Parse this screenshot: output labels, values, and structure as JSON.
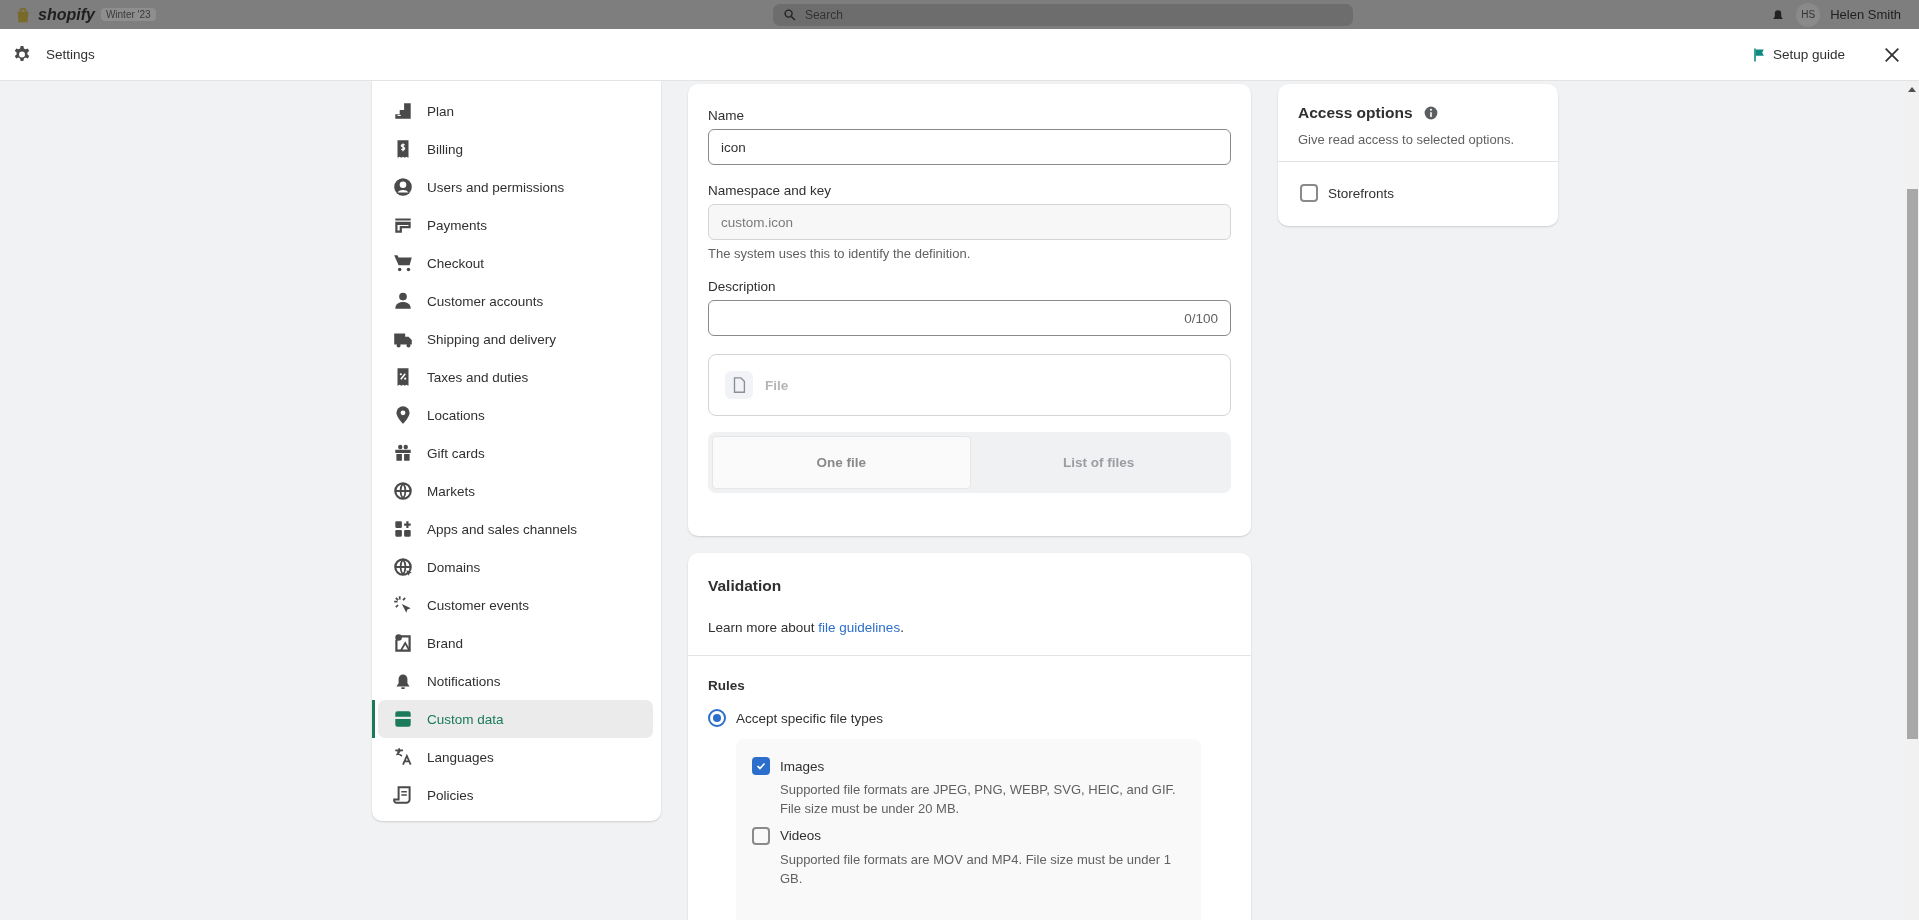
{
  "backdrop": {
    "logo": "shopify",
    "badge": "Winter '23",
    "search_placeholder": "Search",
    "avatar": "HS",
    "user": "Helen Smith"
  },
  "header": {
    "title": "Settings",
    "setup_guide": "Setup guide"
  },
  "sidebar": {
    "items": [
      {
        "label": "Plan",
        "selected": false
      },
      {
        "label": "Billing",
        "selected": false
      },
      {
        "label": "Users and permissions",
        "selected": false
      },
      {
        "label": "Payments",
        "selected": false
      },
      {
        "label": "Checkout",
        "selected": false
      },
      {
        "label": "Customer accounts",
        "selected": false
      },
      {
        "label": "Shipping and delivery",
        "selected": false
      },
      {
        "label": "Taxes and duties",
        "selected": false
      },
      {
        "label": "Locations",
        "selected": false
      },
      {
        "label": "Gift cards",
        "selected": false
      },
      {
        "label": "Markets",
        "selected": false
      },
      {
        "label": "Apps and sales channels",
        "selected": false
      },
      {
        "label": "Domains",
        "selected": false
      },
      {
        "label": "Customer events",
        "selected": false
      },
      {
        "label": "Brand",
        "selected": false
      },
      {
        "label": "Notifications",
        "selected": false
      },
      {
        "label": "Custom data",
        "selected": true
      },
      {
        "label": "Languages",
        "selected": false
      },
      {
        "label": "Policies",
        "selected": false
      }
    ]
  },
  "definition": {
    "name_label": "Name",
    "name_value": "icon",
    "key_label": "Namespace and key",
    "key_value": "custom.icon",
    "key_help": "The system uses this to identify the definition.",
    "description_label": "Description",
    "description_counter": "0/100",
    "type_label": "File",
    "segments": [
      {
        "label": "One file",
        "selected": true
      },
      {
        "label": "List of files",
        "selected": false
      }
    ]
  },
  "validation": {
    "title": "Validation",
    "learn_more": "Learn more about",
    "link": "file guidelines",
    "link_end": ".",
    "rules_title": "Rules",
    "radio": {
      "label": "Accept specific file types",
      "selected": true
    },
    "options": [
      {
        "label": "Images",
        "checked": true,
        "help": "Supported file formats are JPEG, PNG, WEBP, SVG, HEIC, and GIF. File size must be under 20 MB."
      },
      {
        "label": "Videos",
        "checked": false,
        "help": "Supported file formats are MOV and MP4. File size must be under 1 GB."
      }
    ]
  },
  "access": {
    "title": "Access options",
    "subtitle": "Give read access to selected options.",
    "options": [
      {
        "label": "Storefronts",
        "checked": false
      }
    ]
  }
}
